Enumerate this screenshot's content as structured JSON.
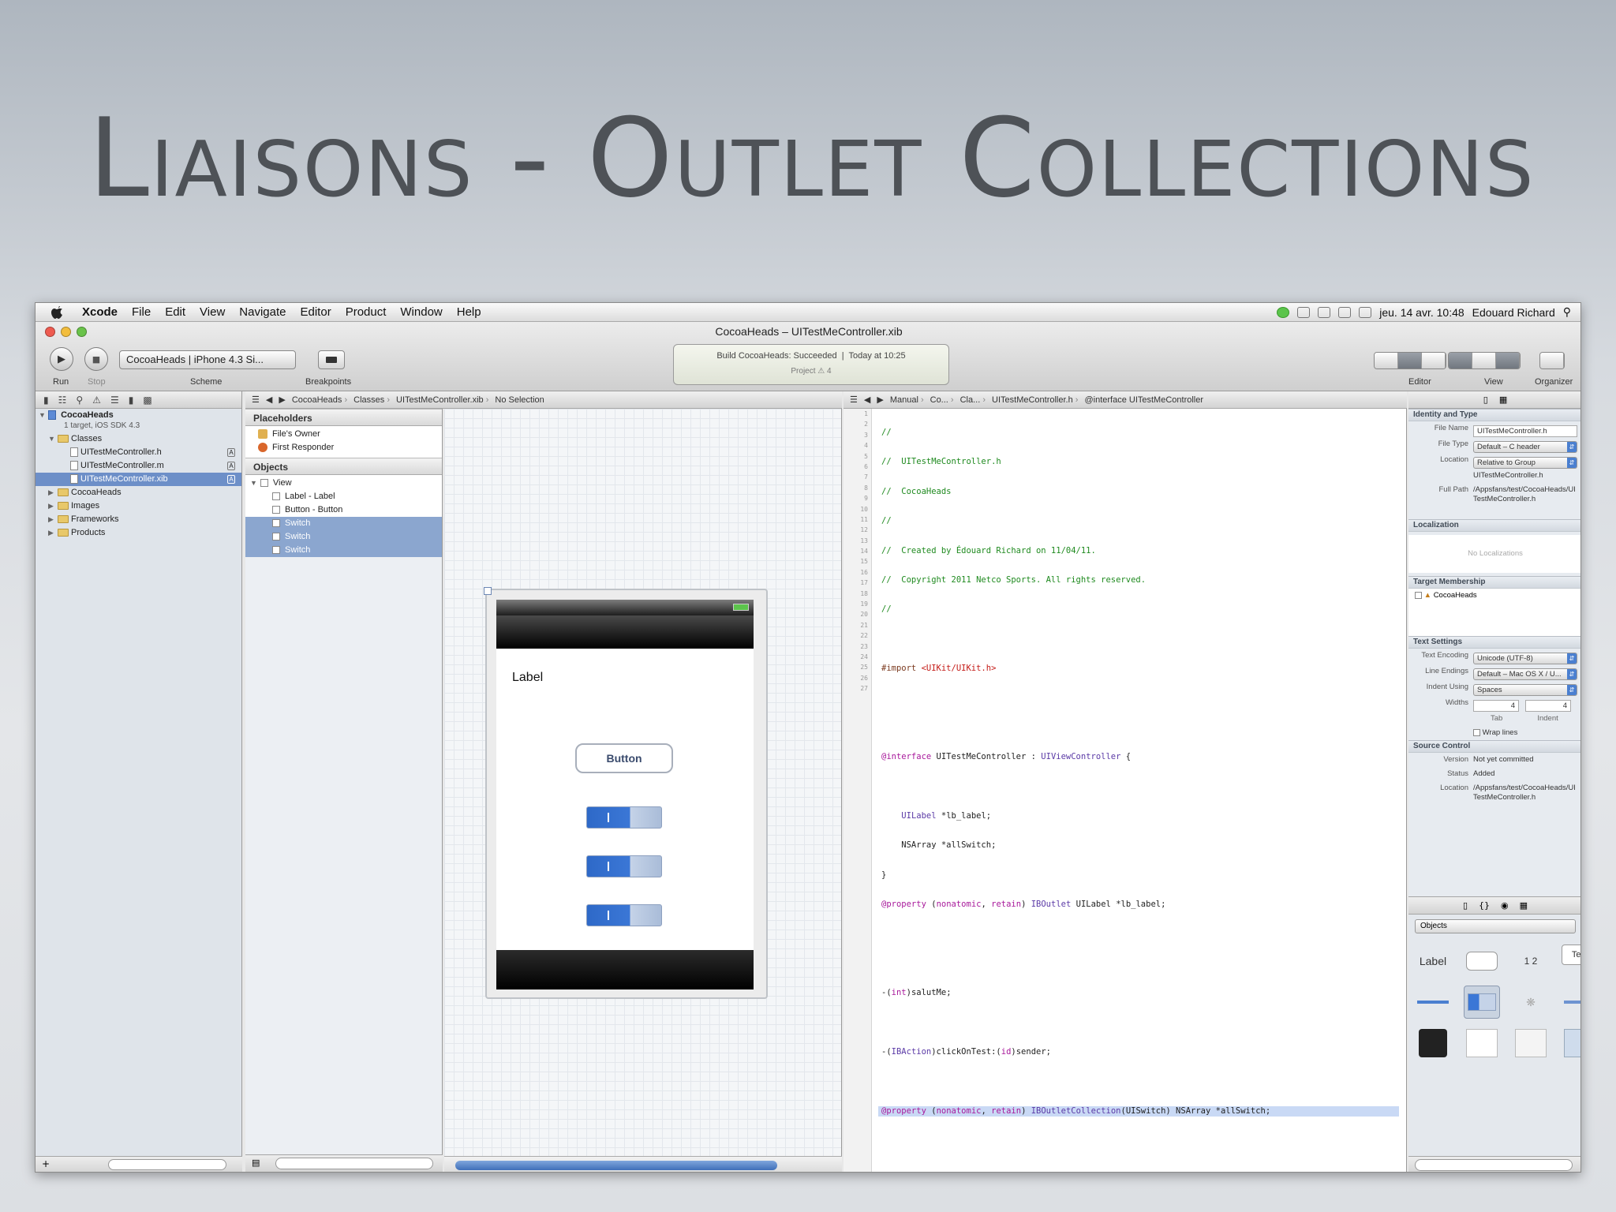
{
  "slide": {
    "title": "Liaisons - Outlet Collections"
  },
  "menubar": {
    "app": "Xcode",
    "items": [
      "File",
      "Edit",
      "View",
      "Navigate",
      "Editor",
      "Product",
      "Window",
      "Help"
    ],
    "clock": "jeu. 14 avr.  10:48",
    "user": "Edouard Richard"
  },
  "window": {
    "title": "CocoaHeads – UITestMeController.xib"
  },
  "toolbar": {
    "run_label": "Run",
    "stop_label": "Stop",
    "scheme_value": "CocoaHeads | iPhone 4.3 Si...",
    "scheme_label": "Scheme",
    "breakpoints_label": "Breakpoints",
    "activity_build": "Build CocoaHeads: Succeeded",
    "activity_time": "Today at 10:25",
    "activity_project": "Project  ⚠ 4",
    "editor_label": "Editor",
    "view_label": "View",
    "organizer_label": "Organizer"
  },
  "navigator": {
    "project": "CocoaHeads",
    "project_sub": "1 target, iOS SDK 4.3",
    "classes": "Classes",
    "files": [
      "UITestMeController.h",
      "UITestMeController.m",
      "UITestMeController.xib"
    ],
    "groups": [
      "CocoaHeads",
      "Images",
      "Frameworks",
      "Products"
    ]
  },
  "ib_jumpbar": [
    "CocoaHeads",
    "Classes",
    "UITestMeController.xib",
    "No Selection"
  ],
  "outline": {
    "placeholders": "Placeholders",
    "files_owner": "File's Owner",
    "first_responder": "First Responder",
    "objects": "Objects",
    "view": "View",
    "children": [
      "Label - Label",
      "Button - Button",
      "Switch",
      "Switch",
      "Switch"
    ]
  },
  "device": {
    "label_text": "Label",
    "button_text": "Button"
  },
  "code_jumpbar": [
    "Manual",
    "Co...",
    "Cla...",
    "UITestMeController.h",
    "@interface UITestMeController"
  ],
  "code": {
    "line_count": 27,
    "highlight_line": 24
  },
  "inspector": {
    "identity_head": "Identity and Type",
    "file_name_k": "File Name",
    "file_name_v": "UITestMeController.h",
    "file_type_k": "File Type",
    "file_type_v": "Default – C header",
    "location_k": "Location",
    "location_v": "Relative to Group",
    "location_file": "UITestMeController.h",
    "full_path_k": "Full Path",
    "full_path_v": "/Appsfans/test/CocoaHeads/UITestMeController.h",
    "localization_head": "Localization",
    "no_localizations": "No Localizations",
    "target_head": "Target Membership",
    "target_item": "CocoaHeads",
    "text_head": "Text Settings",
    "encoding_k": "Text Encoding",
    "encoding_v": "Unicode (UTF-8)",
    "endings_k": "Line Endings",
    "endings_v": "Default – Mac OS X / U...",
    "indent_k": "Indent Using",
    "indent_v": "Spaces",
    "widths_k": "Widths",
    "tab_v": "4",
    "indent_w_v": "4",
    "tab_label": "Tab",
    "indent_label": "Indent",
    "wrap_label": "Wrap lines",
    "sc_head": "Source Control",
    "version_k": "Version",
    "version_v": "Not yet committed",
    "status_k": "Status",
    "status_v": "Added",
    "sc_location_k": "Location",
    "sc_location_v": "/Appsfans/test/CocoaHeads/UITestMeController.h"
  },
  "library": {
    "popup": "Objects",
    "items": [
      "Label",
      "",
      "1 2",
      "Text"
    ]
  }
}
